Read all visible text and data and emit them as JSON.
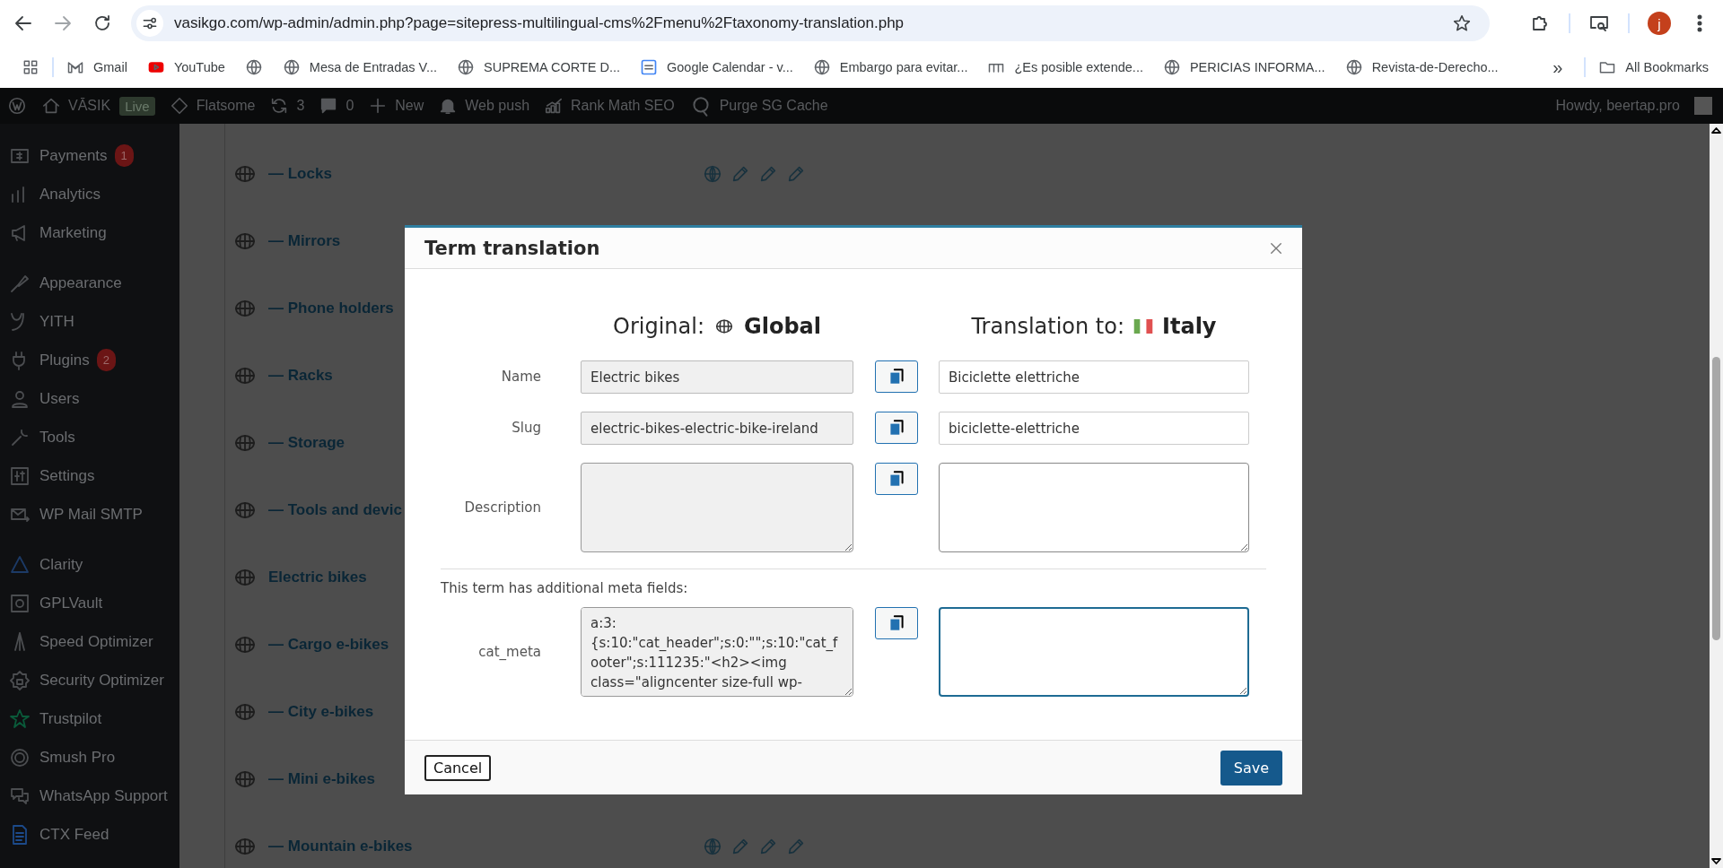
{
  "browser": {
    "url": "vasikgo.com/wp-admin/admin.php?page=sitepress-multilingual-cms%2Fmenu%2Ftaxonomy-translation.php",
    "profile_initial": "j",
    "bookmarks": [
      {
        "kind": "gmail",
        "label": "Gmail"
      },
      {
        "kind": "youtube",
        "label": "YouTube"
      },
      {
        "kind": "globe"
      },
      {
        "kind": "globe",
        "label": "Mesa de Entradas V..."
      },
      {
        "kind": "globe",
        "label": "SUPREMA CORTE D..."
      },
      {
        "kind": "calendar",
        "label": "Google Calendar - v..."
      },
      {
        "kind": "globe",
        "label": "Embargo para evitar..."
      },
      {
        "kind": "m",
        "label": "¿Es posible extende..."
      },
      {
        "kind": "globe",
        "label": "PERICIAS INFORMA..."
      },
      {
        "kind": "globe",
        "label": "Revista-de-Derecho..."
      }
    ],
    "more": "»",
    "all_bookmarks": "All Bookmarks"
  },
  "admin_bar": {
    "site": "VĀSIK",
    "live": "Live",
    "theme": "Flatsome",
    "updates": "3",
    "comments": "0",
    "new": "New",
    "web_push": "Web push",
    "rank_math": "Rank Math SEO",
    "purge": "Purge SG Cache",
    "howdy": "Howdy, beertap.pro"
  },
  "sidebar": {
    "groups": [
      {
        "items": [
          {
            "kind": "payments",
            "label": "Payments",
            "badge": "1"
          },
          {
            "kind": "analytics",
            "label": "Analytics"
          },
          {
            "kind": "marketing",
            "label": "Marketing"
          }
        ]
      },
      {
        "items": [
          {
            "kind": "appearance",
            "label": "Appearance"
          },
          {
            "kind": "yith",
            "label": "YITH"
          },
          {
            "kind": "plugins",
            "label": "Plugins",
            "badge": "2"
          },
          {
            "kind": "users",
            "label": "Users"
          },
          {
            "kind": "tools",
            "label": "Tools"
          },
          {
            "kind": "settings",
            "label": "Settings"
          },
          {
            "kind": "mail",
            "label": "WP Mail SMTP"
          }
        ]
      },
      {
        "items": [
          {
            "kind": "clarity",
            "label": "Clarity"
          },
          {
            "kind": "vault",
            "label": "GPLVault"
          },
          {
            "kind": "speed",
            "label": "Speed Optimizer"
          },
          {
            "kind": "security",
            "label": "Security Optimizer"
          },
          {
            "kind": "trustpilot",
            "label": "Trustpilot"
          },
          {
            "kind": "smush",
            "label": "Smush Pro"
          },
          {
            "kind": "whatsapp",
            "label": "WhatsApp Support"
          },
          {
            "kind": "feed",
            "label": "CTX Feed"
          }
        ]
      }
    ]
  },
  "terms": [
    {
      "label": "— Locks"
    },
    {
      "label": "— Mirrors"
    },
    {
      "label": "— Phone holders"
    },
    {
      "label": "— Racks"
    },
    {
      "label": "— Storage"
    },
    {
      "label": "— Tools and devic"
    },
    {
      "label": "Electric bikes"
    },
    {
      "label": "— Cargo e-bikes"
    },
    {
      "label": "— City e-bikes"
    },
    {
      "label": "— Mini e-bikes"
    },
    {
      "label": "— Mountain e-bikes"
    }
  ],
  "dialog": {
    "title": "Term translation",
    "original_label": "Original:",
    "original_language": "Global",
    "translation_label": "Translation to:",
    "translation_language": "Italy",
    "fields": [
      {
        "kind": "input",
        "label": "Name",
        "original": "Electric bikes",
        "translation": "Biciclette elettriche",
        "focused": false
      },
      {
        "kind": "input",
        "label": "Slug",
        "original": "electric-bikes-electric-bike-ireland",
        "translation": "biciclette-elettriche",
        "focused": false
      },
      {
        "kind": "textarea",
        "label": "Description",
        "focused": false
      }
    ],
    "meta_note": "This term has additional meta fields:",
    "meta_fields": [
      {
        "kind": "textarea",
        "label": "cat_meta",
        "original": "a:3:{s:10:\"cat_header\";s:0:\"\";s:10:\"cat_footer\";s:111235:\"<h2><img class=\"aligncenter size-full wp-",
        "focused": true
      }
    ],
    "cancel": "Cancel",
    "save": "Save"
  }
}
